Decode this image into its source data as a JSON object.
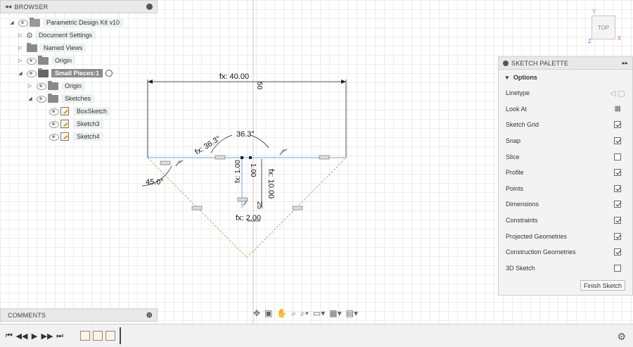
{
  "browser": {
    "title": "BROWSER",
    "root": "Parametric Design Kit v10",
    "items": [
      {
        "label": "Document Settings"
      },
      {
        "label": "Named Views"
      },
      {
        "label": "Origin"
      },
      {
        "label": "Small Pieces:1"
      },
      {
        "label": "Origin"
      },
      {
        "label": "Sketches"
      },
      {
        "label": "BoxSketch"
      },
      {
        "label": "Sketch3"
      },
      {
        "label": "Sketch4"
      }
    ]
  },
  "comments": {
    "title": "COMMENTS"
  },
  "viewcube": {
    "face": "TOP",
    "axis_x": "X",
    "axis_y": "Y",
    "axis_z": "Z"
  },
  "palette": {
    "title": "SKETCH PALETTE",
    "section": "Options",
    "rows": [
      {
        "label": "Linetype",
        "type": "linetype"
      },
      {
        "label": "Look At",
        "type": "icon"
      },
      {
        "label": "Sketch Grid",
        "checked": true
      },
      {
        "label": "Snap",
        "checked": true
      },
      {
        "label": "Slice",
        "checked": false
      },
      {
        "label": "Profile",
        "checked": true
      },
      {
        "label": "Points",
        "checked": true
      },
      {
        "label": "Dimensions",
        "checked": true
      },
      {
        "label": "Constraints",
        "checked": true
      },
      {
        "label": "Projected Geometries",
        "checked": true
      },
      {
        "label": "Construction Geometries",
        "checked": true
      },
      {
        "label": "3D Sketch",
        "checked": false
      }
    ],
    "finish_label": "Finish Sketch"
  },
  "dimensions": {
    "width": "fx: 40.00",
    "offset": "50",
    "angle_left": "fx: 36.3°",
    "angle_right": "36.3°",
    "angle_base": "45.0°",
    "small_v": "fx: 1.00",
    "small_v2": "1.00",
    "height": "fx: 10.00",
    "gap": "25",
    "bottom": "fx: 2.00"
  },
  "colors": {
    "accent_blue": "#6fa8dc",
    "construction": "#d9a066",
    "dim_line": "#222222"
  }
}
